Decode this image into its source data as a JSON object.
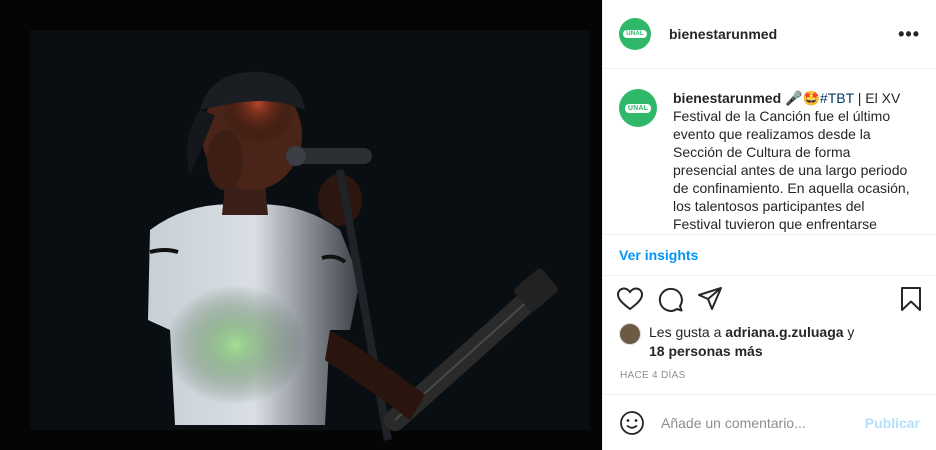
{
  "post": {
    "username": "bienestarunmed",
    "more_label": "•••",
    "avatar_text": "UNAL",
    "caption": {
      "username": "bienestarunmed",
      "emoji": "🎤🤩",
      "hashtag": "#TBT",
      "text": " | El XV Festival de la Canción fue el último evento que realizamos desde la Sección de Cultura de forma presencial antes de una largo periodo de confinamiento. En aquella ocasión, los talentosos participantes del Festival tuvieron que enfrentarse"
    },
    "insights_label": "Ver insights",
    "likes": {
      "prefix": "Les gusta a ",
      "user": "adriana.g.zuluaga",
      "middle": " y",
      "others": "18 personas más"
    },
    "time_ago": "HACE 4 DÍAS",
    "comment_placeholder": "Añade un comentario...",
    "publish_label": "Publicar"
  },
  "colors": {
    "brand_green": "#2fb86a",
    "link_blue": "#0095f6",
    "publish_disabled": "#b2dffc"
  }
}
